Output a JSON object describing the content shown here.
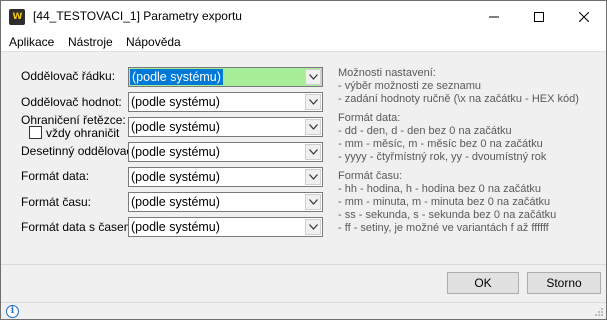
{
  "window": {
    "title": "[44_TESTOVACI_1] Parametry exportu",
    "icon_text": "W"
  },
  "menu": {
    "items": [
      "Aplikace",
      "Nástroje",
      "Nápověda"
    ]
  },
  "form": {
    "fields": [
      {
        "label": "Oddělovač řádku:",
        "value": "(podle systému)"
      },
      {
        "label": "Oddělovač hodnot:",
        "value": "(podle systému)"
      },
      {
        "label": "Ohraničení řetězce:",
        "value": "(podle systému)"
      },
      {
        "label": "Desetinný oddělovač:",
        "value": "(podle systému)"
      },
      {
        "label": "Formát data:",
        "value": "(podle systému)"
      },
      {
        "label": "Formát času:",
        "value": "(podle systému)"
      },
      {
        "label": "Formát data s časem:",
        "value": "(podle systému)"
      }
    ],
    "checkbox_label": "vždy ohraničit",
    "checkbox_checked": false
  },
  "help": {
    "lines": [
      "Možnosti nastavení:",
      "- výběr možnosti ze seznamu",
      "- zadání hodnoty ručně (\\x na začátku - HEX kód)",
      "Formát data:",
      "- dd - den, d - den bez 0 na začátku",
      "- mm - měsíc, m - měsíc bez 0 na začátku",
      "- yyyy - čtyřmístný rok, yy - dvoumístný rok",
      "Formát času:",
      "- hh - hodina, h - hodina bez 0 na začátku",
      "- mm - minuta, m - minuta bez 0 na začátku",
      "- ss - sekunda, s - sekunda bez 0 na začátku",
      "- ff - setiny, je možné ve variantách f až ffffff"
    ]
  },
  "buttons": {
    "ok": "OK",
    "cancel": "Storno"
  },
  "colors": {
    "active_field_bg": "#a6ee98",
    "selection": "#0078d7",
    "icon_brand": "#f3c316"
  }
}
